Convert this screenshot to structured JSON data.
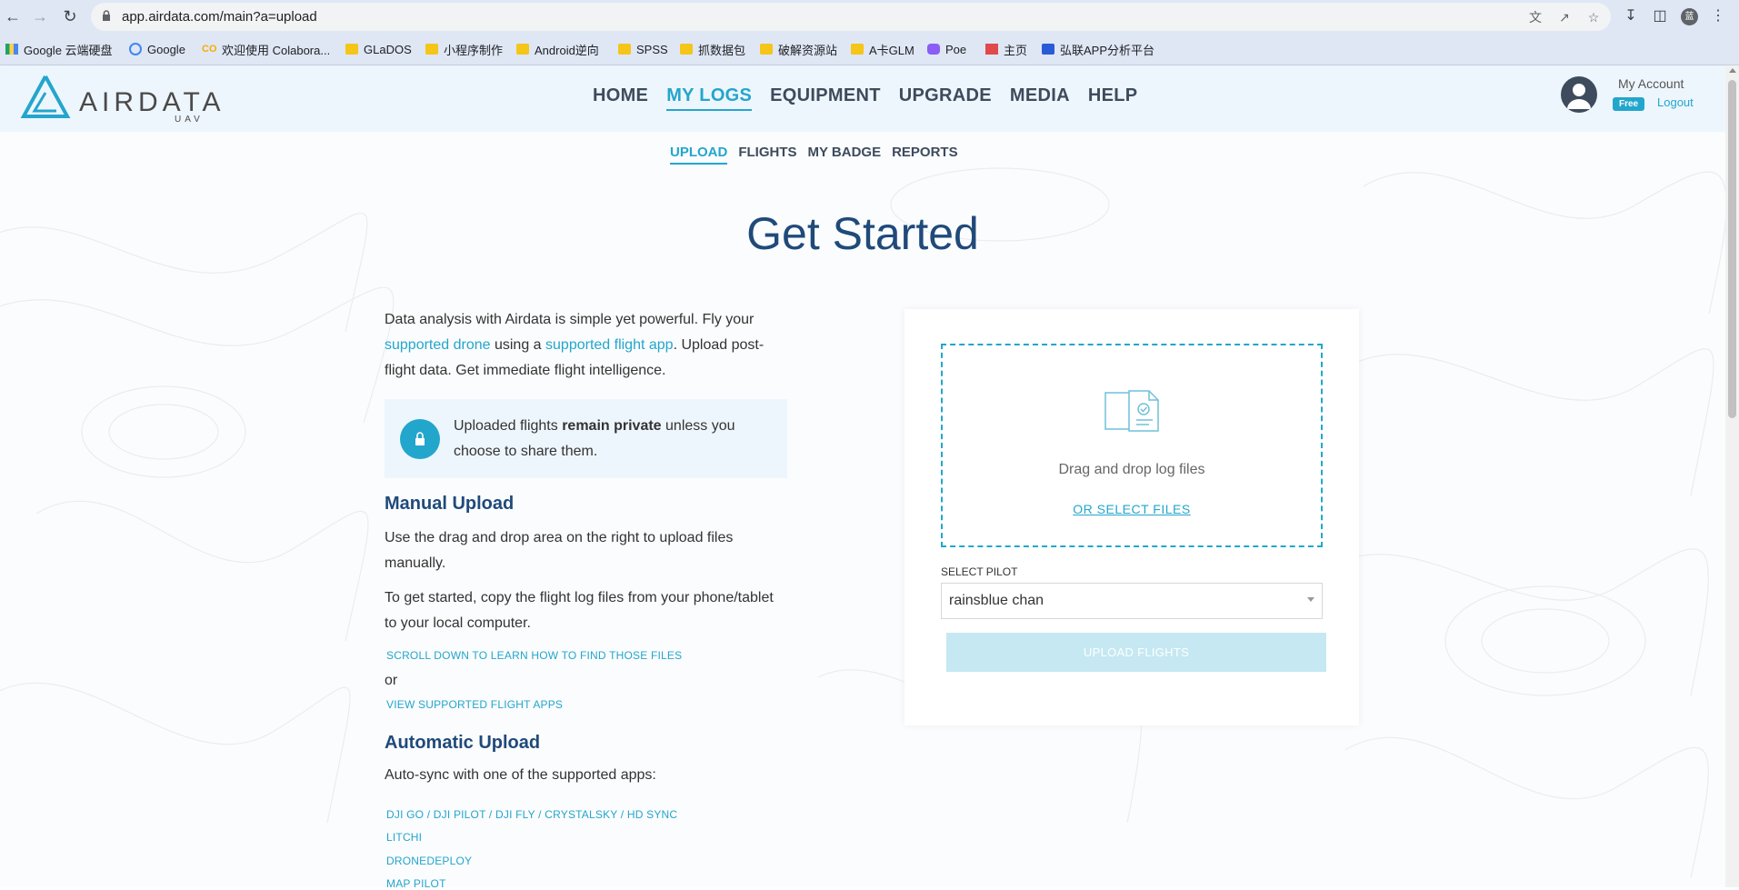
{
  "browser": {
    "url": "app.airdata.com/main?a=upload",
    "profile_initial": "蓝"
  },
  "bookmarks": [
    {
      "label": "Google 云端硬盘",
      "icon": "drive-icon"
    },
    {
      "label": "Google",
      "icon": "google-icon"
    },
    {
      "label": "欢迎使用 Colabora...",
      "icon": "colab-icon"
    },
    {
      "label": "GLaDOS",
      "icon": "folder-icon"
    },
    {
      "label": "小程序制作",
      "icon": "folder-icon"
    },
    {
      "label": "Android逆向",
      "icon": "folder-icon"
    },
    {
      "label": "SPSS",
      "icon": "folder-icon"
    },
    {
      "label": "抓数据包",
      "icon": "folder-icon"
    },
    {
      "label": "破解资源站",
      "icon": "folder-icon"
    },
    {
      "label": "A卡GLM",
      "icon": "folder-icon"
    },
    {
      "label": "Poe",
      "icon": "poe-icon"
    },
    {
      "label": "主页",
      "icon": "home-page-icon"
    },
    {
      "label": "弘联APP分析平台",
      "icon": "app-icon"
    }
  ],
  "header": {
    "logo_text": "AIRDATA",
    "logo_sub": "UAV",
    "nav": [
      "HOME",
      "MY LOGS",
      "EQUIPMENT",
      "UPGRADE",
      "MEDIA",
      "HELP"
    ],
    "active_nav": "MY LOGS",
    "account_label": "My Account",
    "plan_badge": "Free",
    "logout_label": "Logout"
  },
  "subnav": [
    "UPLOAD",
    "FLIGHTS",
    "MY BADGE",
    "REPORTS"
  ],
  "main": {
    "title": "Get Started",
    "intro_1": "Data analysis with Airdata is simple yet powerful. Fly your ",
    "intro_link_1": "supported drone",
    "intro_2": " using a ",
    "intro_link_2": "supported flight app",
    "intro_3": ". Upload post-flight data. Get immediate flight intelligence.",
    "privacy_1": "Uploaded flights ",
    "privacy_bold": "remain private",
    "privacy_2": " unless you choose to share them.",
    "manual_heading": "Manual Upload",
    "manual_p1": "Use the drag and drop area on the right to upload files manually.",
    "manual_p2": "To get started, copy the flight log files from your phone/tablet to your local computer.",
    "scroll_link": "SCROLL DOWN TO LEARN HOW TO FIND THOSE FILES",
    "or_text": "or",
    "view_apps_link": "VIEW SUPPORTED FLIGHT APPS",
    "auto_heading": "Automatic Upload",
    "auto_p": "Auto-sync with one of the supported apps:",
    "auto_apps": [
      "DJI GO / DJI PILOT / DJI FLY / CRYSTALSKY / HD SYNC",
      "LITCHI",
      "DRONEDEPLOY",
      "MAP PILOT"
    ]
  },
  "upload_card": {
    "drop_text": "Drag and drop log files",
    "select_files": "OR SELECT FILES",
    "pilot_label": "SELECT PILOT",
    "pilot_value": "rainsblue chan",
    "upload_button": "UPLOAD FLIGHTS"
  }
}
